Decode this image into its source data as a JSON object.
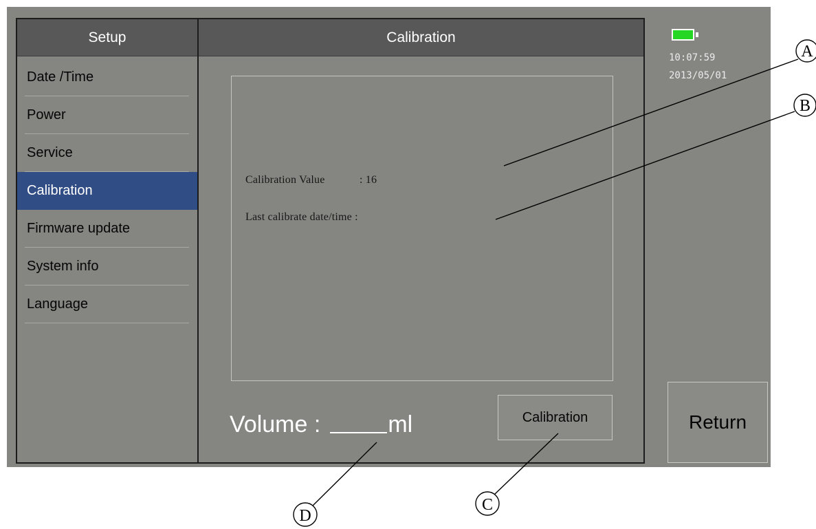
{
  "sidebar": {
    "title": "Setup",
    "items": [
      {
        "label": "Date /Time"
      },
      {
        "label": "Power"
      },
      {
        "label": "Service"
      },
      {
        "label": "Calibration"
      },
      {
        "label": "Firmware update"
      },
      {
        "label": "System info"
      },
      {
        "label": "Language"
      }
    ],
    "active_index": 3
  },
  "content": {
    "title": "Calibration",
    "calibration_value_label": "Calibration Value",
    "calibration_value_separator": ":",
    "calibration_value": "16",
    "last_calibrate_label": "Last calibrate date/time :",
    "volume_label": "Volume :",
    "volume_unit": "ml",
    "calibration_button_label": "Calibration"
  },
  "status": {
    "time": "10:07:59",
    "date": "2013/05/01",
    "battery_icon": "battery-full-icon",
    "battery_color": "#25d625"
  },
  "return_button_label": "Return",
  "callouts": {
    "a": "A",
    "b": "B",
    "c": "C",
    "d": "D"
  },
  "colors": {
    "screen_background": "#858682",
    "header_background": "#575857",
    "active_item_background": "#304d86",
    "text_white": "#ffffff",
    "text_dark": "#050505"
  }
}
